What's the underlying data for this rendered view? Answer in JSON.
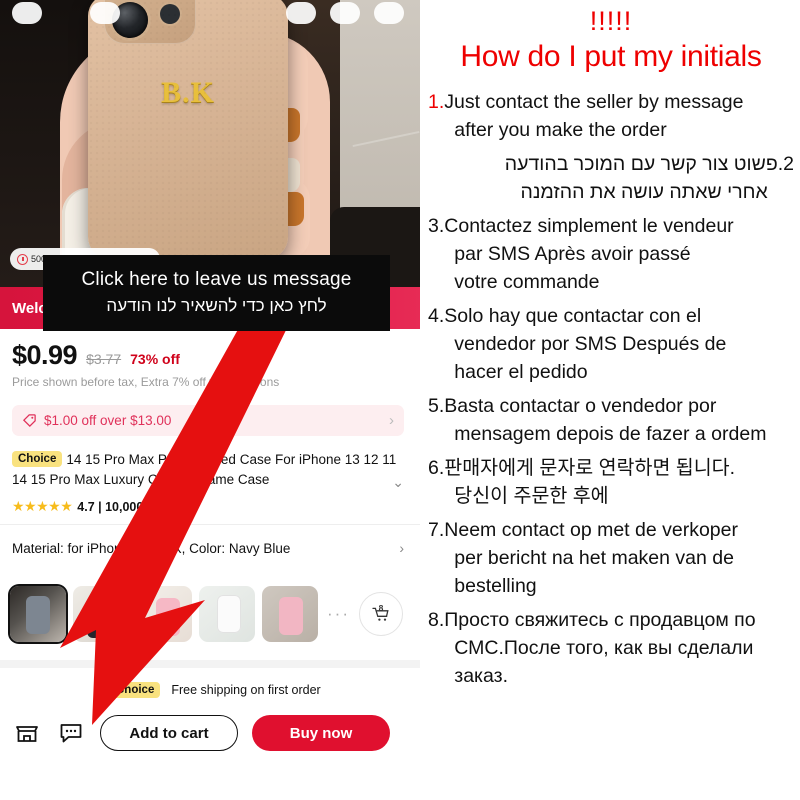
{
  "left": {
    "hero": {
      "initials": "B.K",
      "chips": [
        "",
        "",
        "",
        "",
        ""
      ],
      "timer_chip": "5000+ sold in 24 hours",
      "play_icon": "play-icon"
    },
    "welcome_banner": "Welcome Deal",
    "message_overlay": {
      "english": "Click here to leave us message",
      "hebrew": "לחץ כאן כדי להשאיר לנו הודעה"
    },
    "price": {
      "current": "$0.99",
      "original": "$3.77",
      "discount": "73% off",
      "note": "Price shown before tax, Extra 7% off with coupons"
    },
    "coupon": {
      "icon": "tag-icon",
      "label": "$1.00 off over $13.00",
      "chevron": "›"
    },
    "product": {
      "badge": "Choice",
      "title": "14 15 Pro Max Personalised Case For iPhone 13 12 11 14 15 Pro Max Luxury Custom Name Case",
      "chevron": "⌄",
      "stars": "★★★★★",
      "rating": "4.7 | 10,000+ sold"
    },
    "material": {
      "label": "Material: for iPhone Xr, for X, Color: Navy Blue",
      "chevron": "›"
    },
    "thumbnails": {
      "more": "···",
      "cart_count": "8",
      "cart_icon": "shopping-cart-icon"
    },
    "shipping": {
      "badge": "Choice",
      "label": "Free shipping on first order"
    },
    "bottom_bar": {
      "store_icon": "store-icon",
      "chat_icon": "chat-bubble-icon",
      "add_to_cart": "Add to cart",
      "buy_now": "Buy now"
    },
    "arrow": {
      "name": "red-pointer-arrow",
      "color": "#e51010"
    }
  },
  "right": {
    "exclamation": "!!!!!",
    "headline": "How do I put my initials",
    "headline_color": "#ee0000",
    "steps": [
      {
        "num": "1.",
        "num_red": true,
        "rtl": false,
        "line1": "Just contact the seller by message",
        "line2": "after you make the order"
      },
      {
        "num": "2.",
        "num_red": false,
        "rtl": true,
        "line1": "פשוט צור קשר עם המוכר בהודעה",
        "line2": "אחרי שאתה עושה את ההזמנה"
      },
      {
        "num": "3.",
        "num_red": false,
        "rtl": false,
        "line1": "Contactez simplement le vendeur",
        "line2": "par SMS Après avoir passé",
        "line3": "votre commande"
      },
      {
        "num": "4.",
        "num_red": false,
        "rtl": false,
        "line1": "Solo hay que contactar con el",
        "line2": "vendedor por SMS Después de",
        "line3": "hacer el pedido"
      },
      {
        "num": "5.",
        "num_red": false,
        "rtl": false,
        "line1": "Basta contactar o vendedor por",
        "line2": "mensagem depois de fazer a ordem"
      },
      {
        "num": "6.",
        "num_red": false,
        "rtl": false,
        "line1": "판매자에게 문자로 연락하면 됩니다.",
        "line2": "당신이 주문한 후에"
      },
      {
        "num": "7.",
        "num_red": false,
        "rtl": false,
        "line1": "Neem contact op met de verkoper",
        "line2": "per bericht na het maken van de",
        "line3": "bestelling"
      },
      {
        "num": "8.",
        "num_red": false,
        "rtl": false,
        "line1": "Просто свяжитесь с продавцом по",
        "line2": "СМС.После того, как вы сделали",
        "line3": "заказ."
      }
    ]
  }
}
